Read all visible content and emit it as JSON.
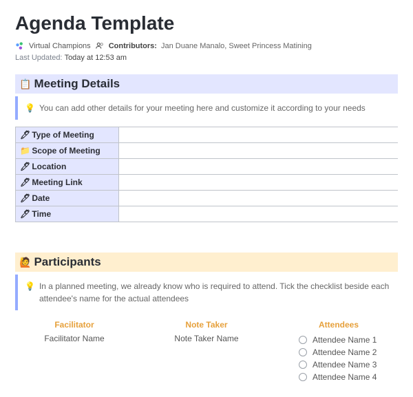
{
  "title": "Agenda Template",
  "owner": "Virtual Champions",
  "contributors": {
    "label": "Contributors:",
    "names": "Jan Duane Manalo, Sweet Princess Matining"
  },
  "updated": {
    "label": "Last Updated:",
    "stamp": "Today at 12:53 am"
  },
  "sections": {
    "details": {
      "heading": "Meeting Details",
      "tip": "You can add other details for your meeting here and customize it according to your needs",
      "rows": [
        {
          "icon": "pen-icon",
          "glyph": "🖊",
          "label": "Type of Meeting",
          "value": ""
        },
        {
          "icon": "folder-icon",
          "glyph": "📁",
          "label": "Scope of Meeting",
          "value": ""
        },
        {
          "icon": "pen-icon",
          "glyph": "🖊",
          "label": "Location",
          "value": ""
        },
        {
          "icon": "pen-icon",
          "glyph": "🖊",
          "label": "Meeting Link",
          "value": ""
        },
        {
          "icon": "pen-icon",
          "glyph": "🖊",
          "label": "Date",
          "value": ""
        },
        {
          "icon": "pen-icon",
          "glyph": "🖊",
          "label": "Time",
          "value": ""
        }
      ]
    },
    "participants": {
      "heading": "Participants",
      "tip": "In a planned meeting, we already know who is required to attend. Tick the checklist beside each attendee's name for the actual attendees",
      "columns": {
        "facilitator": {
          "head": "Facilitator",
          "value": "Facilitator Name"
        },
        "notetaker": {
          "head": "Note Taker",
          "value": "Note Taker Name"
        },
        "attendees": {
          "head": "Attendees",
          "items": [
            "Attendee Name 1",
            "Attendee Name 2",
            "Attendee Name 3",
            "Attendee Name 4"
          ]
        }
      }
    }
  },
  "icons": {
    "details_header": "📋",
    "participants_header": "🙋",
    "bulb": "💡"
  }
}
